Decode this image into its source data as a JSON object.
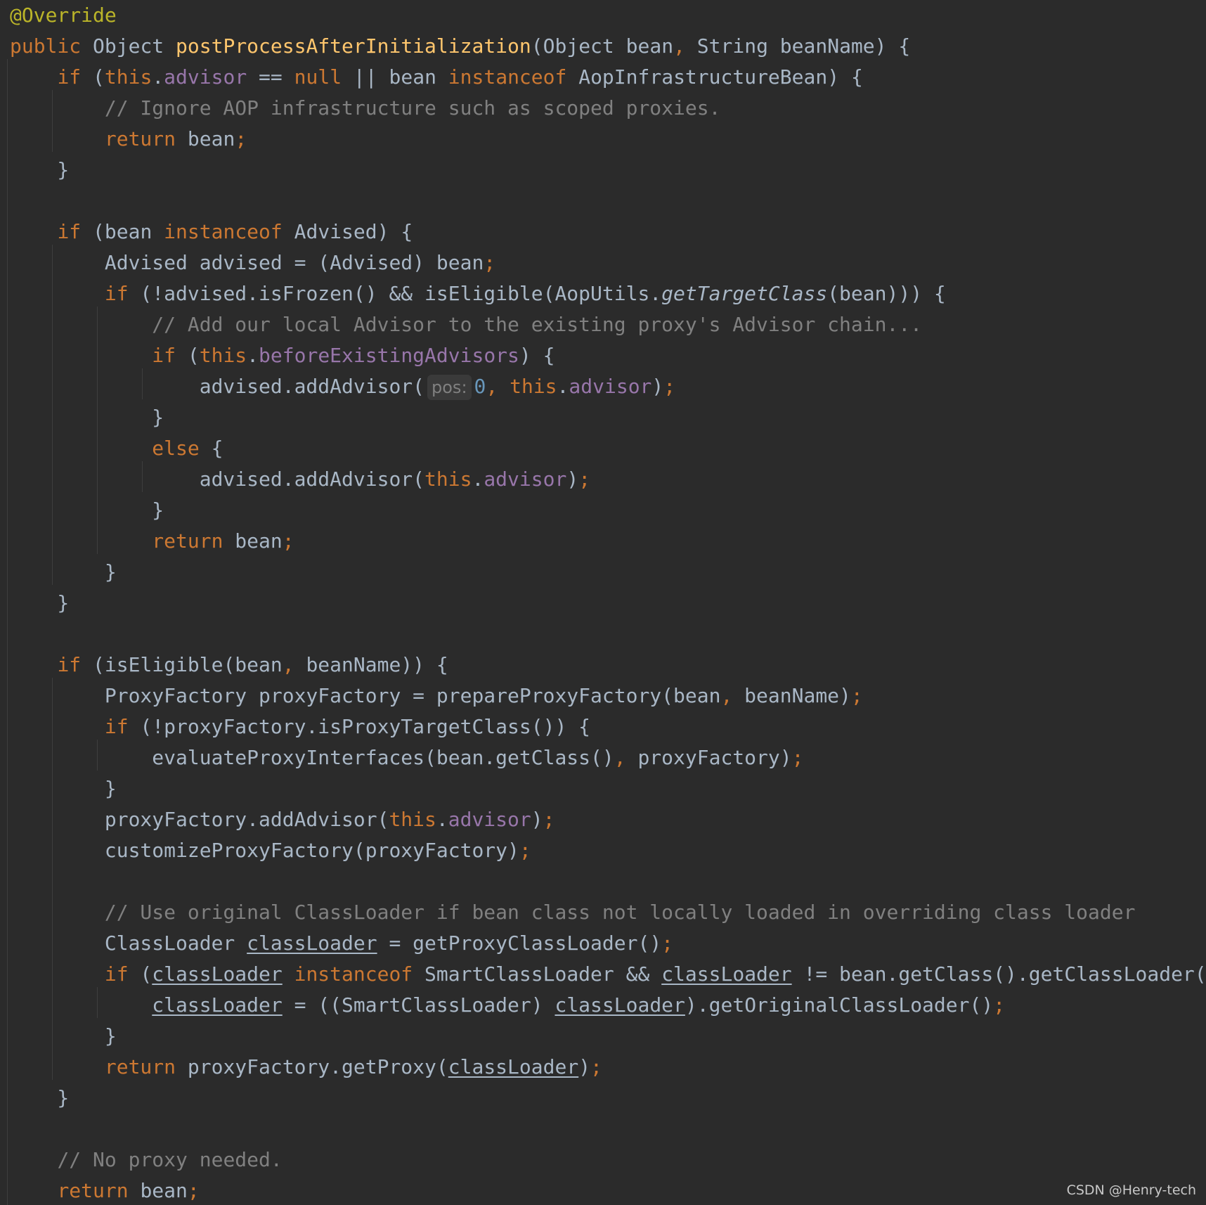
{
  "editor": {
    "lines": [
      [
        {
          "t": "@Override",
          "c": "an"
        }
      ],
      [
        {
          "t": "public ",
          "c": "kw"
        },
        {
          "t": "Object "
        },
        {
          "t": "postProcessAfterInitialization",
          "c": "fn"
        },
        {
          "t": "(Object bean"
        },
        {
          "t": ",",
          "c": "pn"
        },
        {
          "t": " String beanName) {"
        }
      ],
      [
        {
          "t": "    "
        },
        {
          "t": "if",
          "c": "kw"
        },
        {
          "t": " ("
        },
        {
          "t": "this",
          "c": "kw"
        },
        {
          "t": "."
        },
        {
          "t": "advisor",
          "c": "fd"
        },
        {
          "t": " == "
        },
        {
          "t": "null",
          "c": "kw"
        },
        {
          "t": " || bean "
        },
        {
          "t": "instanceof",
          "c": "kw"
        },
        {
          "t": " AopInfrastructureBean) {"
        }
      ],
      [
        {
          "t": "        "
        },
        {
          "t": "// Ignore AOP infrastructure such as scoped proxies.",
          "c": "cm"
        }
      ],
      [
        {
          "t": "        "
        },
        {
          "t": "return",
          "c": "kw"
        },
        {
          "t": " bean"
        },
        {
          "t": ";",
          "c": "pn"
        }
      ],
      [
        {
          "t": "    }"
        }
      ],
      [],
      [
        {
          "t": "    "
        },
        {
          "t": "if",
          "c": "kw"
        },
        {
          "t": " (bean "
        },
        {
          "t": "instanceof",
          "c": "kw"
        },
        {
          "t": " Advised) {"
        }
      ],
      [
        {
          "t": "        Advised advised = (Advised) bean"
        },
        {
          "t": ";",
          "c": "pn"
        }
      ],
      [
        {
          "t": "        "
        },
        {
          "t": "if",
          "c": "kw"
        },
        {
          "t": " (!advised.isFrozen() && isEligible(AopUtils."
        },
        {
          "t": "getTargetClass",
          "c": "it"
        },
        {
          "t": "(bean))) {"
        }
      ],
      [
        {
          "t": "            "
        },
        {
          "t": "// Add our local Advisor to the existing proxy's Advisor chain...",
          "c": "cm"
        }
      ],
      [
        {
          "t": "            "
        },
        {
          "t": "if",
          "c": "kw"
        },
        {
          "t": " ("
        },
        {
          "t": "this",
          "c": "kw"
        },
        {
          "t": "."
        },
        {
          "t": "beforeExistingAdvisors",
          "c": "fd"
        },
        {
          "t": ") {"
        }
      ],
      [
        {
          "t": "                advised.addAdvisor("
        },
        {
          "t": "pos:",
          "c": "hint"
        },
        {
          "t": "0",
          "c": "nm"
        },
        {
          "t": ",",
          "c": "pn"
        },
        {
          "t": " "
        },
        {
          "t": "this",
          "c": "kw"
        },
        {
          "t": "."
        },
        {
          "t": "advisor",
          "c": "fd"
        },
        {
          "t": ")"
        },
        {
          "t": ";",
          "c": "pn"
        }
      ],
      [
        {
          "t": "            }"
        }
      ],
      [
        {
          "t": "            "
        },
        {
          "t": "else",
          "c": "kw"
        },
        {
          "t": " {"
        }
      ],
      [
        {
          "t": "                advised.addAdvisor("
        },
        {
          "t": "this",
          "c": "kw"
        },
        {
          "t": "."
        },
        {
          "t": "advisor",
          "c": "fd"
        },
        {
          "t": ")"
        },
        {
          "t": ";",
          "c": "pn"
        }
      ],
      [
        {
          "t": "            }"
        }
      ],
      [
        {
          "t": "            "
        },
        {
          "t": "return",
          "c": "kw"
        },
        {
          "t": " bean"
        },
        {
          "t": ";",
          "c": "pn"
        }
      ],
      [
        {
          "t": "        }"
        }
      ],
      [
        {
          "t": "    }"
        }
      ],
      [],
      [
        {
          "t": "    "
        },
        {
          "t": "if",
          "c": "kw"
        },
        {
          "t": " (isEligible(bean"
        },
        {
          "t": ",",
          "c": "pn"
        },
        {
          "t": " beanName)) {"
        }
      ],
      [
        {
          "t": "        ProxyFactory proxyFactory = prepareProxyFactory(bean"
        },
        {
          "t": ",",
          "c": "pn"
        },
        {
          "t": " beanName)"
        },
        {
          "t": ";",
          "c": "pn"
        }
      ],
      [
        {
          "t": "        "
        },
        {
          "t": "if",
          "c": "kw"
        },
        {
          "t": " (!proxyFactory.isProxyTargetClass()) {"
        }
      ],
      [
        {
          "t": "            evaluateProxyInterfaces(bean.getClass()"
        },
        {
          "t": ",",
          "c": "pn"
        },
        {
          "t": " proxyFactory)"
        },
        {
          "t": ";",
          "c": "pn"
        }
      ],
      [
        {
          "t": "        }"
        }
      ],
      [
        {
          "t": "        proxyFactory.addAdvisor("
        },
        {
          "t": "this",
          "c": "kw"
        },
        {
          "t": "."
        },
        {
          "t": "advisor",
          "c": "fd"
        },
        {
          "t": ")"
        },
        {
          "t": ";",
          "c": "pn"
        }
      ],
      [
        {
          "t": "        customizeProxyFactory(proxyFactory)"
        },
        {
          "t": ";",
          "c": "pn"
        }
      ],
      [],
      [
        {
          "t": "        "
        },
        {
          "t": "// Use original ClassLoader if bean class not locally loaded in overriding class loader",
          "c": "cm"
        }
      ],
      [
        {
          "t": "        ClassLoader "
        },
        {
          "t": "classLoader",
          "c": "ul"
        },
        {
          "t": " = getProxyClassLoader()"
        },
        {
          "t": ";",
          "c": "pn"
        }
      ],
      [
        {
          "t": "        "
        },
        {
          "t": "if",
          "c": "kw"
        },
        {
          "t": " ("
        },
        {
          "t": "classLoader",
          "c": "ul"
        },
        {
          "t": " "
        },
        {
          "t": "instanceof",
          "c": "kw"
        },
        {
          "t": " SmartClassLoader && "
        },
        {
          "t": "classLoader",
          "c": "ul"
        },
        {
          "t": " != bean.getClass().getClassLoader()) {"
        }
      ],
      [
        {
          "t": "            "
        },
        {
          "t": "classLoader",
          "c": "ul"
        },
        {
          "t": " = ((SmartClassLoader) "
        },
        {
          "t": "classLoader",
          "c": "ul"
        },
        {
          "t": ").getOriginalClassLoader()"
        },
        {
          "t": ";",
          "c": "pn"
        }
      ],
      [
        {
          "t": "        }"
        }
      ],
      [
        {
          "t": "        "
        },
        {
          "t": "return",
          "c": "kw"
        },
        {
          "t": " proxyFactory.getProxy("
        },
        {
          "t": "classLoader",
          "c": "ul"
        },
        {
          "t": ")"
        },
        {
          "t": ";",
          "c": "pn"
        }
      ],
      [
        {
          "t": "    }"
        }
      ],
      [],
      [
        {
          "t": "    "
        },
        {
          "t": "// No proxy needed.",
          "c": "cm"
        }
      ],
      [
        {
          "t": "    "
        },
        {
          "t": "return",
          "c": "kw"
        },
        {
          "t": " bean"
        },
        {
          "t": ";",
          "c": "pn"
        }
      ]
    ]
  },
  "watermark": "CSDN @Henry-tech"
}
